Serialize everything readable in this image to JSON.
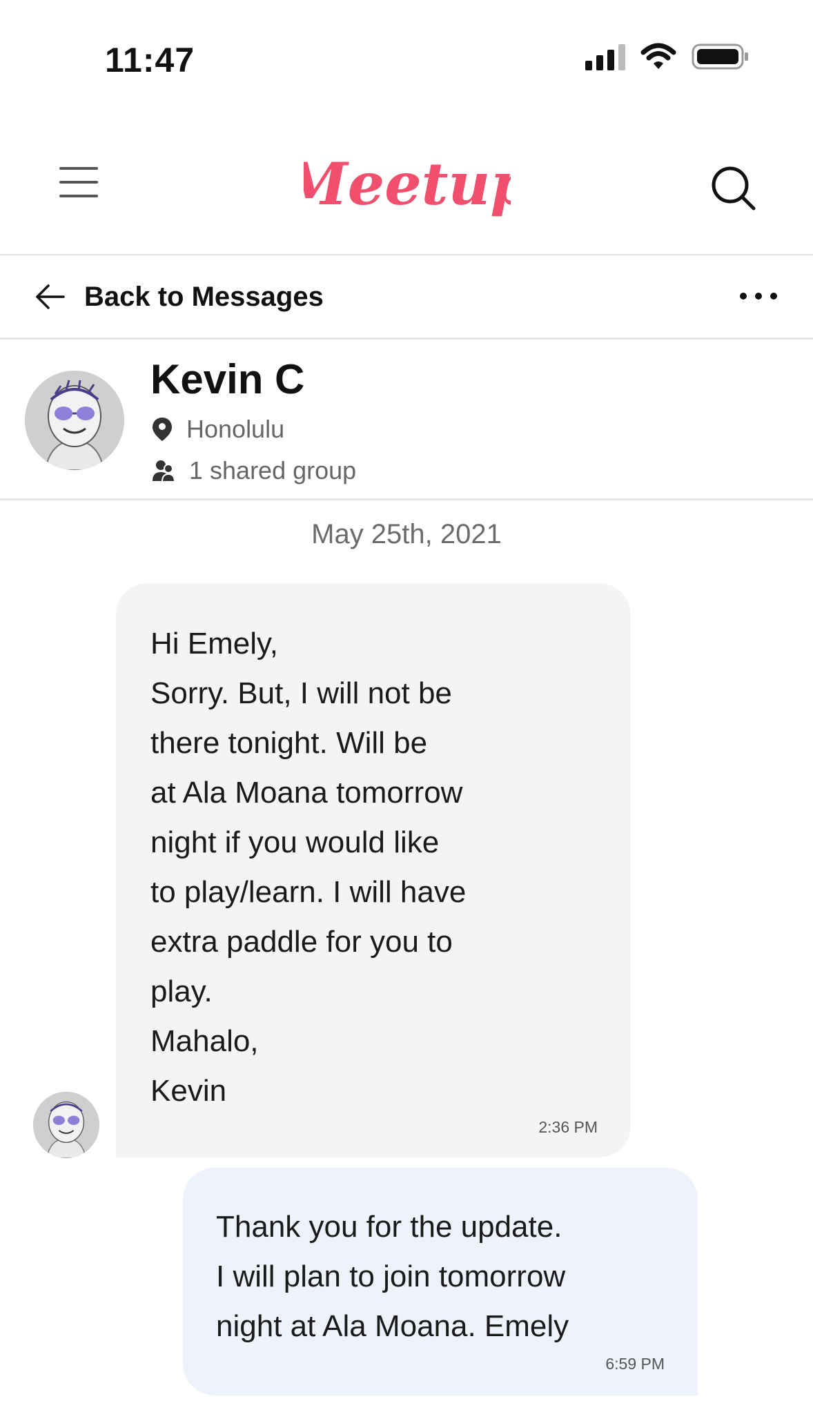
{
  "status_bar": {
    "time": "11:47"
  },
  "header": {
    "logo_text": "Meetup",
    "brand_color": "#f0506e"
  },
  "back_bar": {
    "label": "Back to Messages"
  },
  "profile": {
    "name": "Kevin C",
    "location": "Honolulu",
    "shared_groups": "1 shared group"
  },
  "conversation": {
    "date": "May 25th, 2021",
    "messages": [
      {
        "direction": "incoming",
        "text": "Hi Emely,\nSorry.  But, I will not be\nthere tonight.  Will be\nat Ala Moana tomorrow\nnight if you would like\nto play/learn.  I will have\nextra paddle for you to\nplay.\nMahalo,\nKevin",
        "time": "2:36 PM"
      },
      {
        "direction": "outgoing",
        "text": "Thank you for the update.\nI will plan to join tomorrow\nnight at Ala Moana.  Emely",
        "time": "6:59 PM"
      }
    ]
  }
}
